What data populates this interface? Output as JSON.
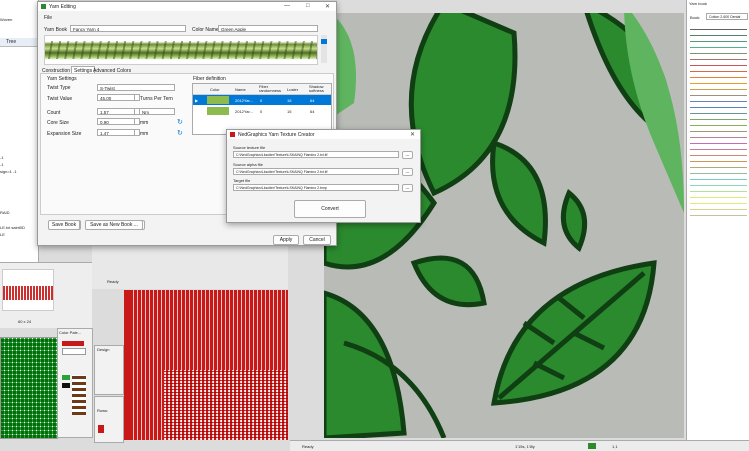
{
  "bg_window": {
    "tree_tab": "Tree",
    "tree_labels": [
      "Woven",
      "-1",
      "-1",
      "sign=1 -1",
      "RAID",
      "LE.txt  saint0D",
      "LE"
    ],
    "thumb_label": "60 x 24",
    "color_panel_title": "Color Pale...",
    "design_panel_title": "Design",
    "rows_label": "Rows:",
    "ready1": "Ready",
    "ready2": "Ready",
    "status_coords": "1'15s, 1'l8y",
    "status_page": "1,1",
    "status_value": "1.1",
    "yarn_book_title": "Yarn book",
    "yarn_book_book_label": "Book:",
    "yarn_book_book_value": "Cotton 2-600 Dental"
  },
  "yarn_editing": {
    "title": "Yarn Editing",
    "menu_file": "File",
    "yarn_book_label": "Yarn Book",
    "yarn_book_value": "Fancy Yarn 4",
    "color_name_label": "Color Name",
    "color_name_value": "Green Apple",
    "tabs": [
      "Construction",
      "Settings",
      "Advanced Colors"
    ],
    "yarn_settings_label": "Yarn Settings",
    "twist_type_label": "Twist Type",
    "twist_type_value": "S-Twist",
    "twist_value_label": "Twist Value",
    "twist_value_value": "45,00",
    "twist_unit": "Turns Per Tern",
    "count_label": "Count",
    "count_value": "1,57",
    "count_unit": "Nm",
    "core_size_label": "Core Size",
    "core_size_value": "0,90",
    "core_size_unit": "mm",
    "expansion_size_label": "Expansion Size",
    "expansion_size_value": "1,47",
    "expansion_size_unit": "mm",
    "fiber_def_label": "Fiber definition",
    "fiber_table_headers": [
      "Color",
      "Name",
      "Fiber randomness",
      "Luster",
      "Shadow softness"
    ],
    "fiber_rows": [
      {
        "name": "2012Yar...",
        "randomness": "0",
        "luster": "15",
        "shadow": "64",
        "color": "#8dbb4e"
      },
      {
        "name": "2012Yar...",
        "randomness": "0",
        "luster": "15",
        "shadow": "64",
        "color": "#8dbb4e"
      }
    ],
    "save_book": "Save Book",
    "save_as_new_book": "Save as New Book ...",
    "apply": "Apply",
    "cancel": "Cancel"
  },
  "texture_creator": {
    "title": "NedGraphics Yarn Texture Creator",
    "source_texture_label": "Source texture file",
    "source_texture_value": "C:\\NedGraphics\\Lksoiter\\Texture\\LSKAINQ Flamino 2.txt.tif",
    "source_alpha_label": "Source alpha file",
    "source_alpha_value": "C:\\NedGraphics\\Lksoiter\\Texture\\LSKAINQ Flamino 2.txt.tif",
    "target_label": "Target file",
    "target_value": "C:\\NedGraphics\\Lksoiter\\Texture\\LSKAINQ Flamino 2.bmp",
    "browse": "...",
    "convert": "Convert"
  },
  "colors": {
    "leaf_dark": "#2b8a2e",
    "leaf_light": "#5fb45f",
    "outline": "#0f3f12",
    "fabric_red": "#c81818",
    "selection": "#0078d7"
  }
}
